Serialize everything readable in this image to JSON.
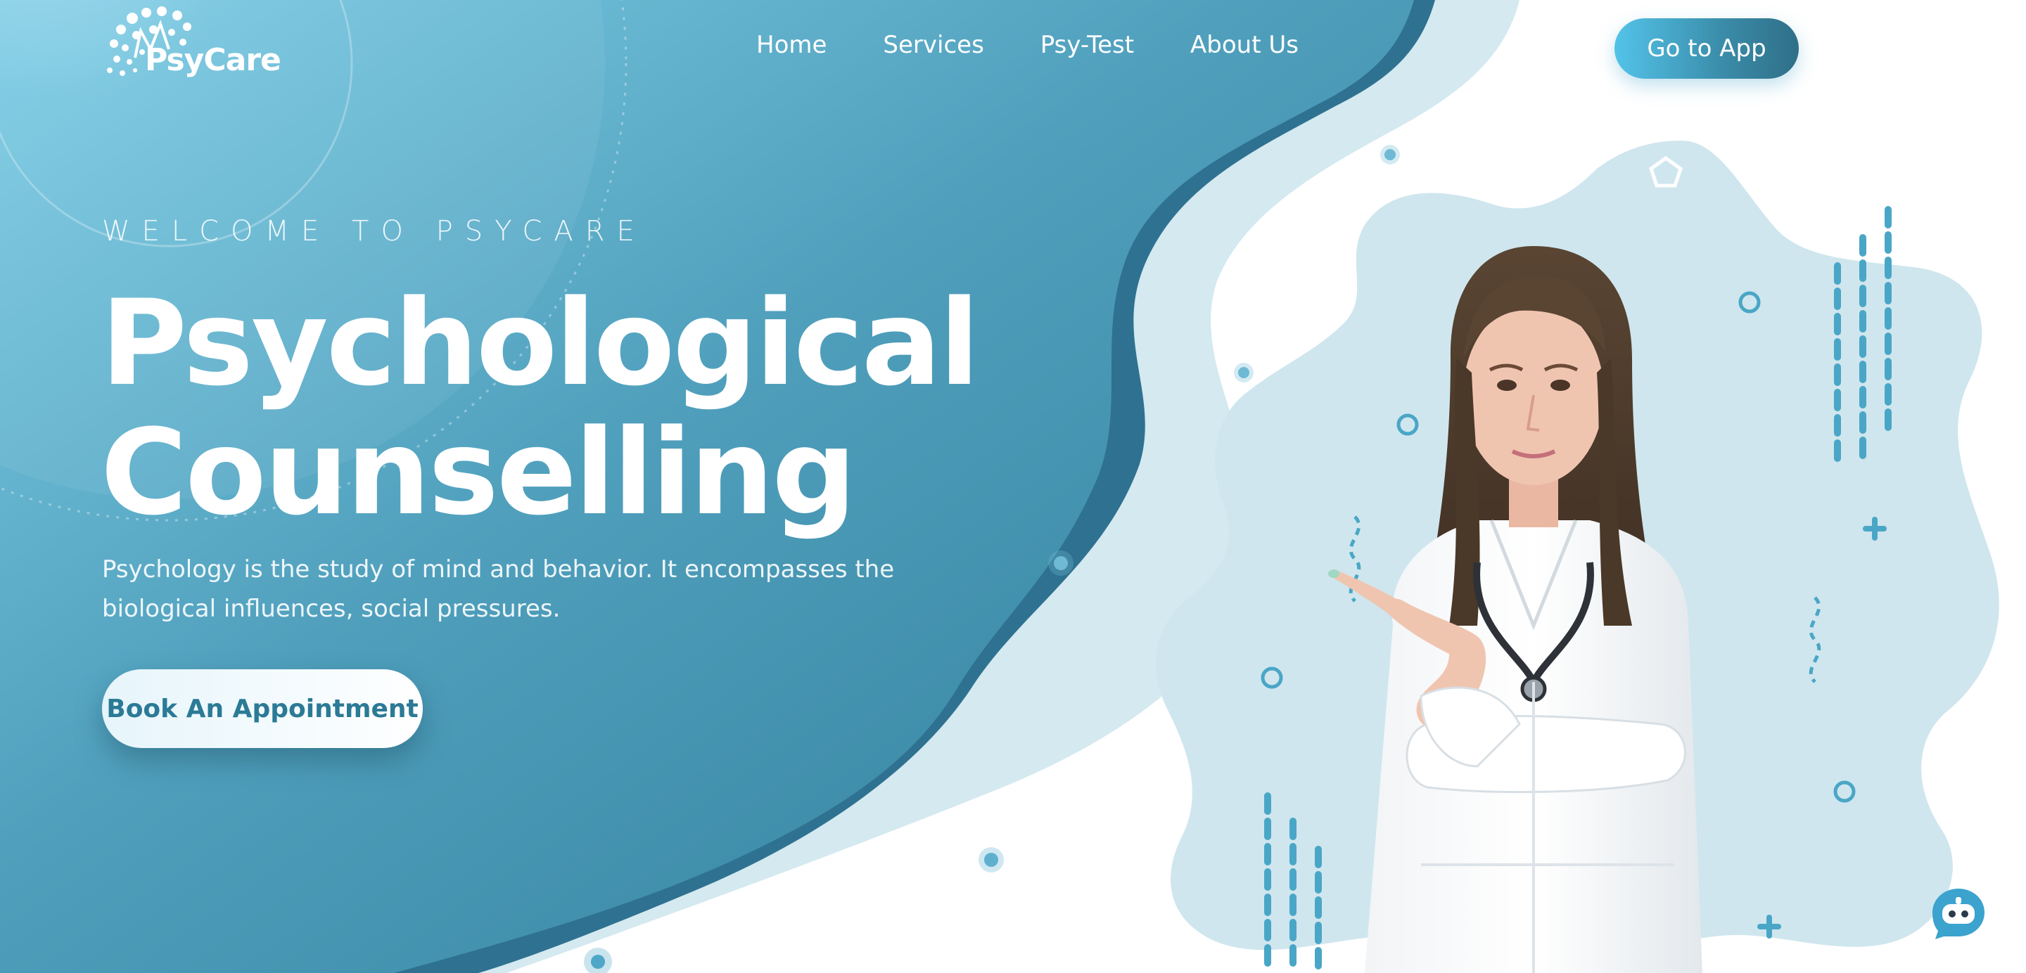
{
  "brand": {
    "name": "PsyCare"
  },
  "nav": {
    "items": [
      {
        "label": "Home"
      },
      {
        "label": "Services"
      },
      {
        "label": "Psy-Test"
      },
      {
        "label": "About Us"
      }
    ],
    "cta_label": "Go to App"
  },
  "hero": {
    "eyebrow": "WELCOME TO PSYCARE",
    "title_line1": "Psychological",
    "title_line2": "Counselling",
    "description": "Psychology is the study of mind and behavior. It encompasses the biological influences, social pressures.",
    "cta_label": "Book An Appointment"
  },
  "colors": {
    "teal_dark": "#2f6f88",
    "teal": "#3f8eaa",
    "teal_light": "#7fc9e1",
    "pale_blue": "#cfe6ee",
    "accent_cyan": "#53c3e9",
    "white": "#ffffff"
  },
  "icons": {
    "logo": "brain-network-icon",
    "chatbot": "chatbot-icon"
  }
}
